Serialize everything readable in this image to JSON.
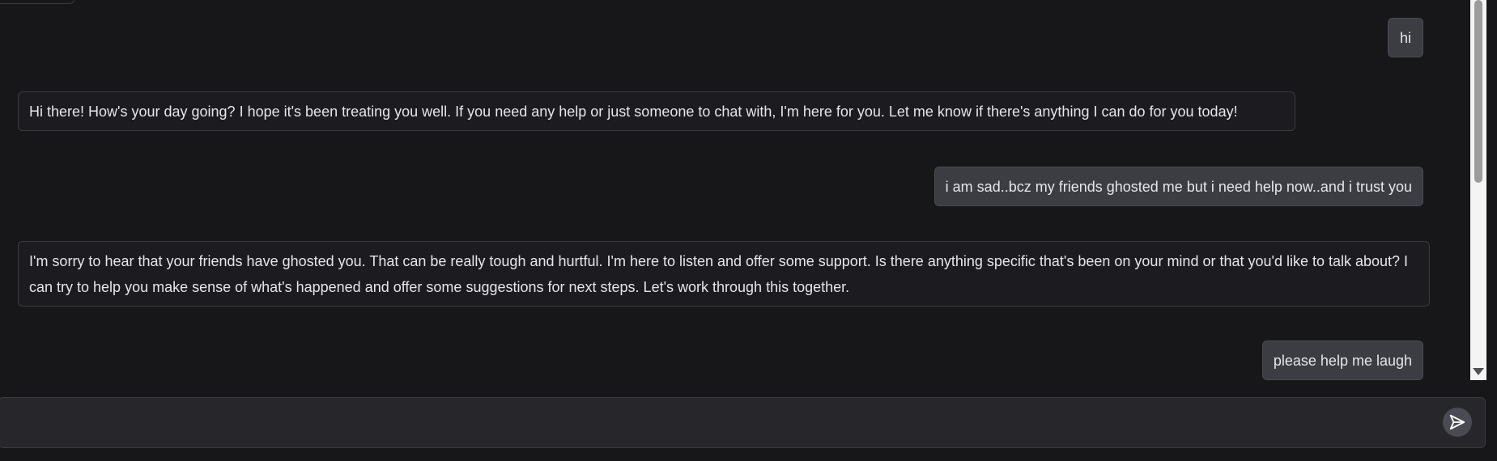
{
  "messages": [
    {
      "role": "user",
      "text": "hi"
    },
    {
      "role": "assistant",
      "text": "Hi there! How's your day going? I hope it's been treating you well. If you need any help or just someone to chat with, I'm here for you. Let me know if there's anything I can do for you today!"
    },
    {
      "role": "user",
      "text": "i am sad..bcz my friends ghosted me but i need help now..and i trust you"
    },
    {
      "role": "assistant",
      "text": "I'm sorry to hear that your friends have ghosted you. That can be really tough and hurtful. I'm here to listen and offer some support. Is there anything specific that's been on your mind or that you'd like to talk about? I can try to help you make sense of what's happened and offer some suggestions for next steps. Let's work through this together."
    },
    {
      "role": "user",
      "text": "please help me laugh"
    }
  ],
  "composer": {
    "value": "",
    "send_icon": "send-icon"
  },
  "colors": {
    "background": "#17171a",
    "user_bubble": "#3c3d43",
    "assistant_bubble_border": "#3a3a40",
    "text": "#e6e6ea"
  }
}
